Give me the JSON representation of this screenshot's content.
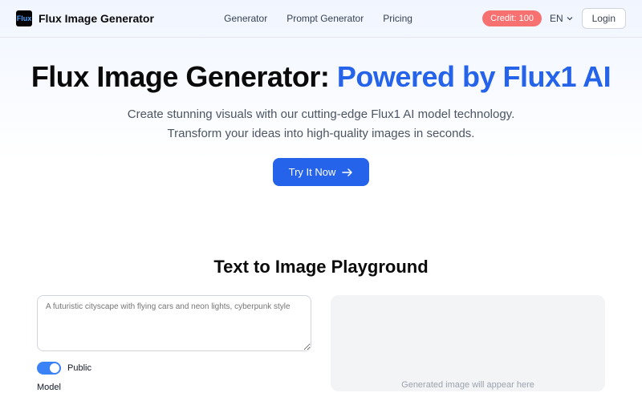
{
  "header": {
    "logo_text": "Flux",
    "brand": "Flux Image Generator",
    "nav": {
      "generator": "Generator",
      "prompt_generator": "Prompt Generator",
      "pricing": "Pricing"
    },
    "credit": "Credit: 100",
    "lang": "EN",
    "login": "Login"
  },
  "hero": {
    "title_main": "Flux Image Generator: ",
    "title_accent": "Powered by Flux1 AI",
    "sub_line1": "Create stunning visuals with our cutting-edge Flux1 AI model technology.",
    "sub_line2": "Transform your ideas into high-quality images in seconds.",
    "cta": "Try It Now"
  },
  "playground": {
    "title": "Text to Image Playground",
    "prompt_placeholder": "A futuristic cityscape with flying cars and neon lights, cyberpunk style",
    "public_label": "Public",
    "model_label": "Model",
    "preview_placeholder": "Generated image will appear here"
  }
}
